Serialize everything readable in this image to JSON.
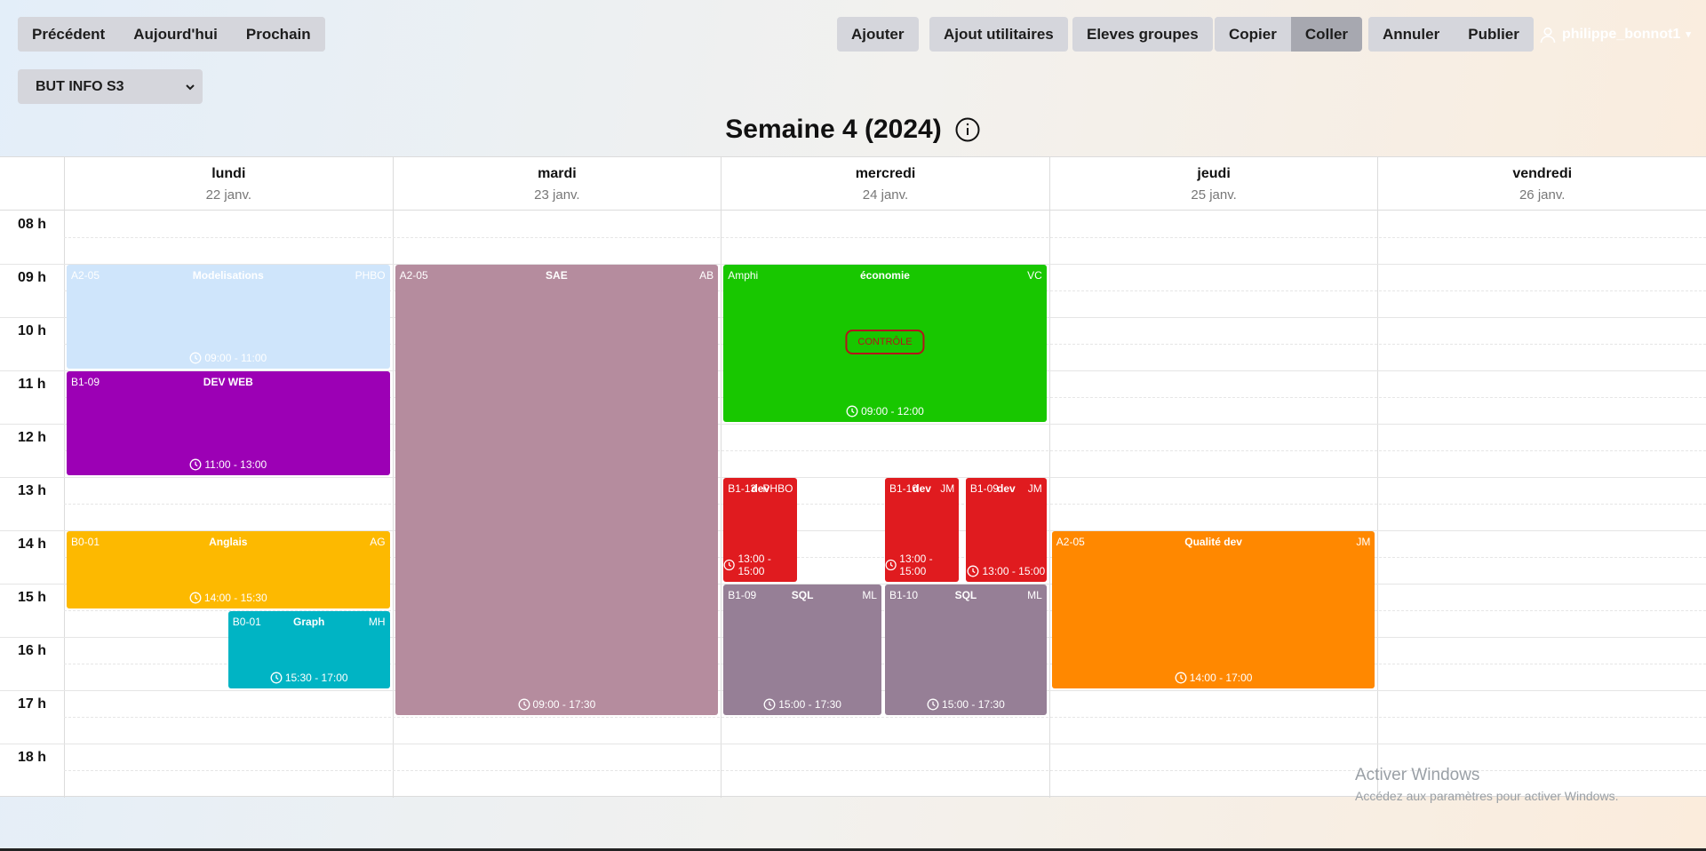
{
  "nav": {
    "prev": "Précédent",
    "today": "Aujourd'hui",
    "next": "Prochain"
  },
  "actions": {
    "add": "Ajouter",
    "add_utilities": "Ajout utilitaires",
    "student_groups": "Eleves groupes",
    "copy": "Copier",
    "paste": "Coller",
    "cancel": "Annuler",
    "publish": "Publier"
  },
  "user": {
    "name": "philippe_bonnot1"
  },
  "group_select": {
    "value": "BUT INFO S3"
  },
  "week_title": "Semaine 4 (2024)",
  "days": [
    {
      "name": "lundi",
      "date": "22 janv."
    },
    {
      "name": "mardi",
      "date": "23 janv."
    },
    {
      "name": "mercredi",
      "date": "24 janv."
    },
    {
      "name": "jeudi",
      "date": "25 janv."
    },
    {
      "name": "vendredi",
      "date": "26 janv."
    }
  ],
  "hours": [
    "08 h",
    "09 h",
    "10 h",
    "11 h",
    "12 h",
    "13 h",
    "14 h",
    "15 h",
    "16 h",
    "17 h",
    "18 h"
  ],
  "events": [
    {
      "day": 0,
      "room": "A2-05",
      "subject": "Modelisations",
      "teacher": "PHBO",
      "start": "09:00",
      "end": "11:00",
      "time": "09:00 - 11:00",
      "color": "#cfe5fb"
    },
    {
      "day": 0,
      "room": "B1-09",
      "subject": "DEV WEB",
      "teacher": "",
      "start": "11:00",
      "end": "13:00",
      "time": "11:00 - 13:00",
      "color": "#9c00b5"
    },
    {
      "day": 0,
      "room": "B0-01",
      "subject": "Anglais",
      "teacher": "AG",
      "start": "14:00",
      "end": "15:30",
      "time": "14:00 - 15:30",
      "color": "#fdb900"
    },
    {
      "day": 0,
      "room": "B0-01",
      "subject": "Graph",
      "teacher": "MH",
      "start": "15:30",
      "end": "17:00",
      "time": "15:30 - 17:00",
      "color": "#00b4c4"
    },
    {
      "day": 1,
      "room": "A2-05",
      "subject": "SAE",
      "teacher": "AB",
      "start": "09:00",
      "end": "17:30",
      "time": "09:00 - 17:30",
      "color": "#b58c9e"
    },
    {
      "day": 2,
      "room": "Amphi",
      "subject": "économie",
      "teacher": "VC",
      "start": "09:00",
      "end": "12:00",
      "time": "09:00 - 12:00",
      "color": "#18c700",
      "badge": "CONTRÔLE"
    },
    {
      "day": 2,
      "room": "B1-13",
      "subject": "dev",
      "teacher": "PHBO",
      "start": "13:00",
      "end": "15:00",
      "time": "13:00 - 15:00",
      "color": "#e01b1f"
    },
    {
      "day": 2,
      "room": "B1-10",
      "subject": "dev",
      "teacher": "JM",
      "start": "13:00",
      "end": "15:00",
      "time": "13:00 - 15:00",
      "color": "#e01b1f"
    },
    {
      "day": 2,
      "room": "B1-09",
      "subject": "dev",
      "teacher": "JM",
      "start": "13:00",
      "end": "15:00",
      "time": "13:00 - 15:00",
      "color": "#e01b1f"
    },
    {
      "day": 2,
      "room": "B1-09",
      "subject": "SQL",
      "teacher": "ML",
      "start": "15:00",
      "end": "17:30",
      "time": "15:00 - 17:30",
      "color": "#967f96"
    },
    {
      "day": 2,
      "room": "B1-10",
      "subject": "SQL",
      "teacher": "ML",
      "start": "15:00",
      "end": "17:30",
      "time": "15:00 - 17:30",
      "color": "#967f96"
    },
    {
      "day": 3,
      "room": "A2-05",
      "subject": "Qualité dev",
      "teacher": "JM",
      "start": "14:00",
      "end": "17:00",
      "time": "14:00 - 17:00",
      "color": "#ff8800"
    }
  ],
  "watermark": {
    "title": "Activer Windows",
    "subtitle": "Accédez aux paramètres pour activer Windows."
  }
}
